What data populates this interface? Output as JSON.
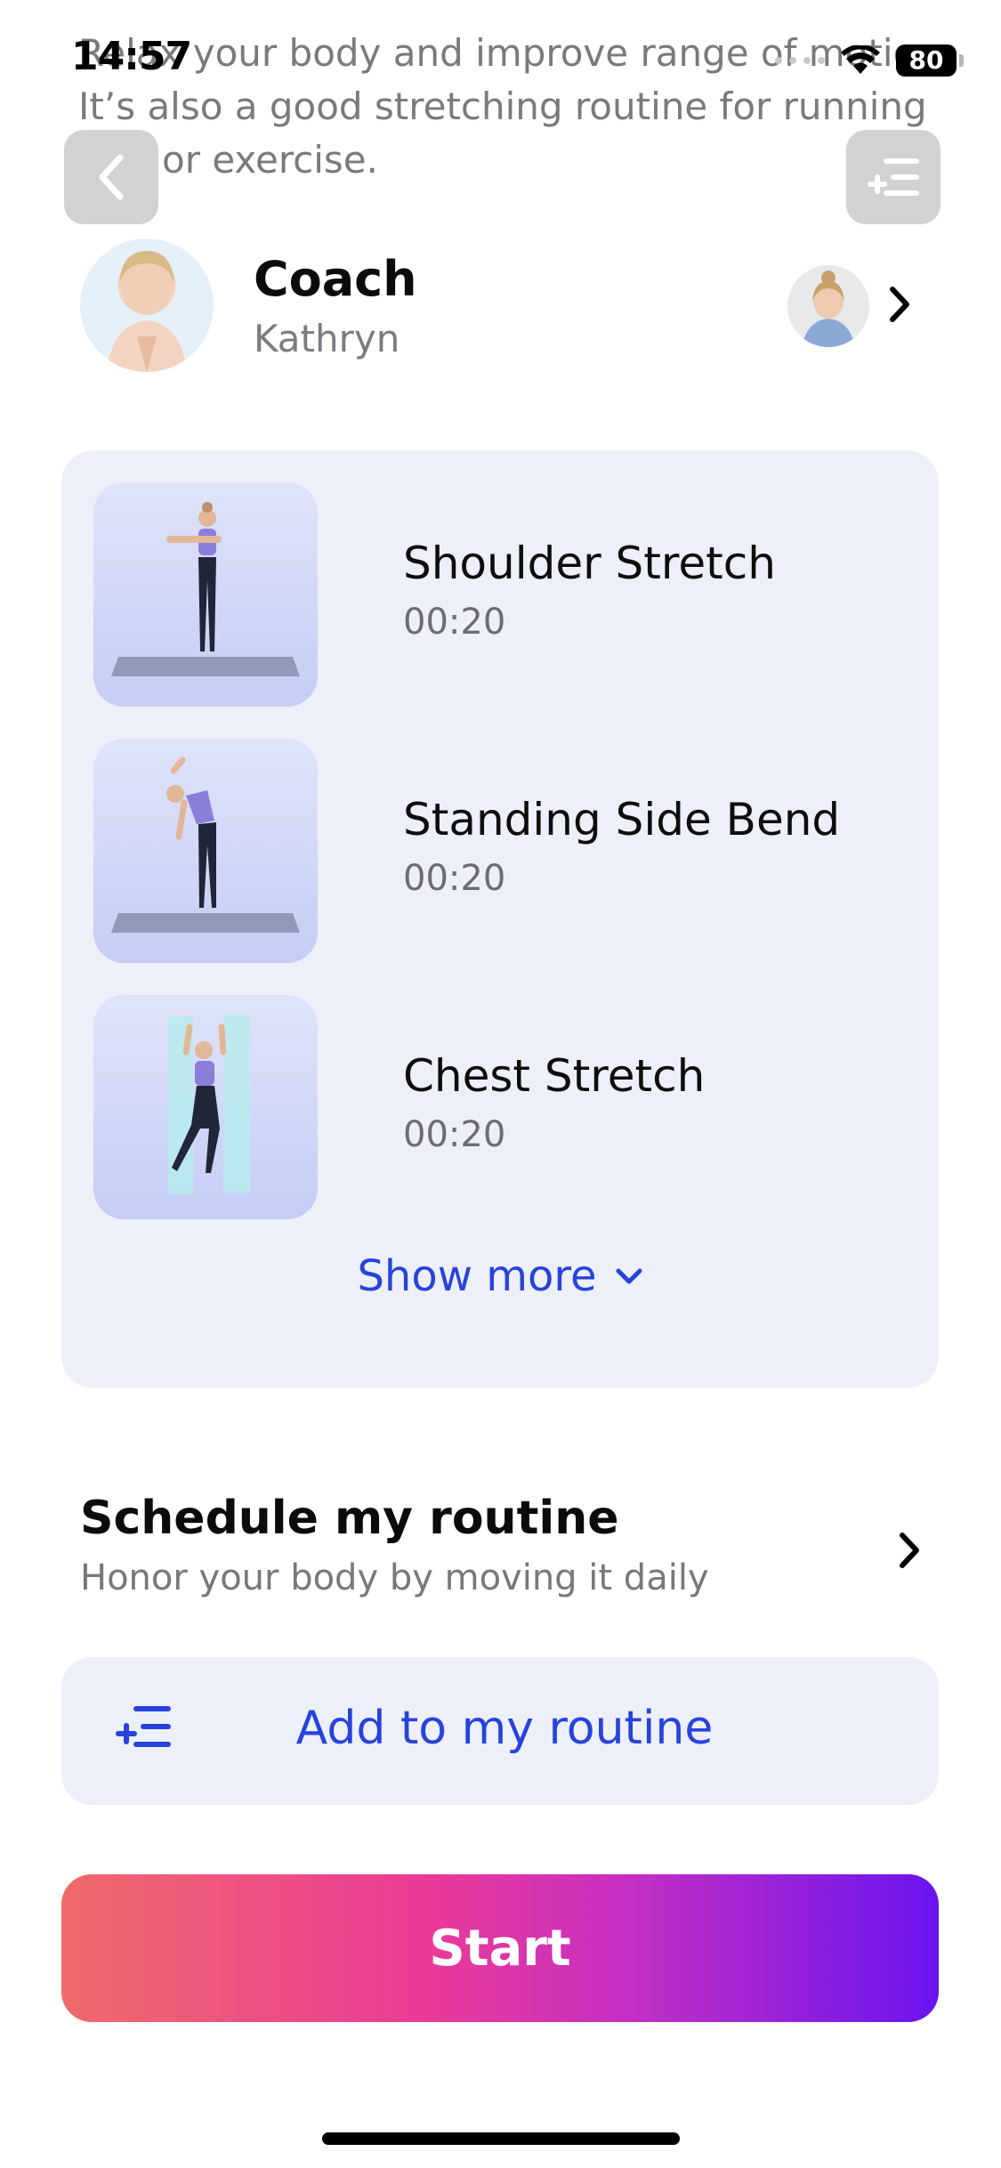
{
  "status_bar": {
    "time": "14:57",
    "battery": "80"
  },
  "description": {
    "line1": "Relax your body and improve range of motion.",
    "line2": "It’s also a good stretching routine for running",
    "line3": "or exercise."
  },
  "coach": {
    "title": "Coach",
    "name": "Kathryn"
  },
  "exercises": [
    {
      "name": "Shoulder Stretch",
      "duration": "00:20"
    },
    {
      "name": "Standing Side Bend",
      "duration": "00:20"
    },
    {
      "name": "Chest Stretch",
      "duration": "00:20"
    }
  ],
  "show_more_label": "Show more",
  "schedule": {
    "title": "Schedule my routine",
    "subtitle": "Honor your body by moving it daily"
  },
  "add_routine_label": "Add to my routine",
  "start_label": "Start",
  "colors": {
    "accent_blue": "#2743dc",
    "card_bg": "#eef0f9",
    "start_gradient": [
      "#ef6a6a",
      "#ea3a98",
      "#6a14f0"
    ]
  },
  "icons": [
    "back-chevron-icon",
    "add-to-list-icon",
    "wifi-icon",
    "chevron-right-icon",
    "chevron-down-icon"
  ]
}
